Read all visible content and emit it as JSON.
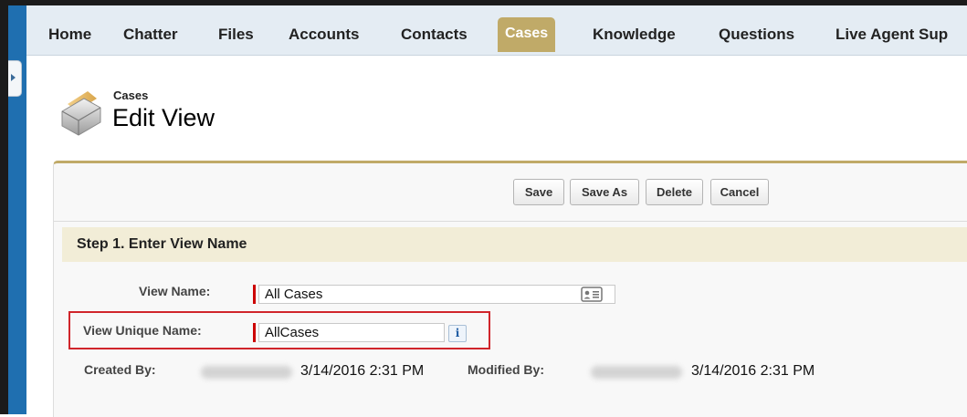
{
  "tabs": [
    {
      "label": "Home",
      "active": false
    },
    {
      "label": "Chatter",
      "active": false
    },
    {
      "label": "Files",
      "active": false
    },
    {
      "label": "Accounts",
      "active": false
    },
    {
      "label": "Contacts",
      "active": false
    },
    {
      "label": "Cases",
      "active": true
    },
    {
      "label": "Knowledge",
      "active": false
    },
    {
      "label": "Questions",
      "active": false
    },
    {
      "label": "Live Agent Sup",
      "active": false
    }
  ],
  "header": {
    "object_name": "Cases",
    "title": "Edit View",
    "icon": "cases-folder-icon"
  },
  "buttons": {
    "save": "Save",
    "save_as": "Save As",
    "delete": "Delete",
    "cancel": "Cancel"
  },
  "step1": {
    "heading": "Step 1. Enter View Name"
  },
  "form": {
    "view_name_label": "View Name:",
    "view_name_value": "All Cases",
    "unique_name_label": "View Unique Name:",
    "unique_name_value": "AllCases",
    "created_by_label": "Created By:",
    "created_date": "3/14/2016 2:31 PM",
    "modified_by_label": "Modified By:",
    "modified_date": "3/14/2016 2:31 PM"
  },
  "colors": {
    "active_tab": "#c0aa68",
    "required_marker": "#cc0000",
    "highlight_box": "#d0252b",
    "side_strip": "#1f6fb0"
  }
}
